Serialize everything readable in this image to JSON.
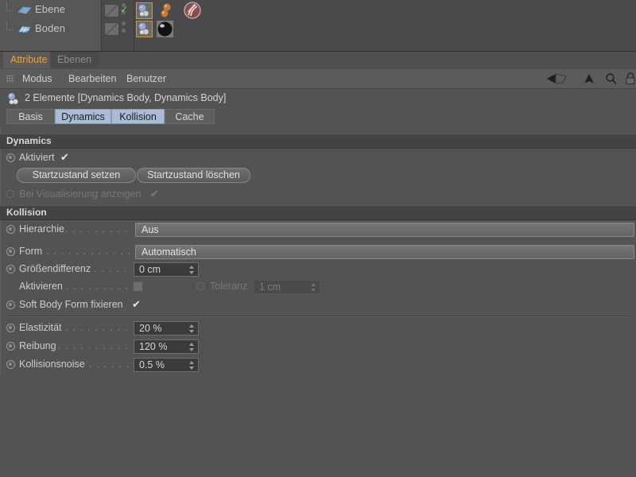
{
  "object_manager": {
    "rows": [
      {
        "name": "Ebene",
        "icon": "plane-icon",
        "visibility_dots": 2,
        "enabled_check": "✓",
        "tags": [
          "dynamics-body-tag",
          "sphere-tag",
          "sphere-tag",
          "deformer-tag"
        ]
      },
      {
        "name": "Boden",
        "icon": "floor-grid-icon",
        "visibility_dots": 2,
        "enabled_check": "",
        "tags": [
          "dynamics-body-tag",
          "material-tag"
        ]
      }
    ]
  },
  "panel_tabs": {
    "active": "Attribute",
    "inactive": "Ebenen"
  },
  "menu": {
    "grip": "grip-icon",
    "items": [
      "Modus",
      "Bearbeiten",
      "Benutzer"
    ],
    "tools": [
      "back-arrow-icon",
      "up-arrow-icon",
      "search-icon",
      "lock-icon"
    ]
  },
  "object_title": {
    "icon": "dynamics-body-icon",
    "text": "2 Elemente [Dynamics Body, Dynamics Body]"
  },
  "sub_tabs": [
    {
      "label": "Basis",
      "selected": false
    },
    {
      "label": "Dynamics",
      "selected": true
    },
    {
      "label": "Kollision",
      "selected": true
    },
    {
      "label": "Cache",
      "selected": false
    }
  ],
  "sections": {
    "dynamics": {
      "title": "Dynamics",
      "aktiviert": {
        "label": "Aktiviert",
        "checked": true,
        "check_glyph": "✔"
      },
      "buttons": [
        {
          "label": "Startzustand setzen"
        },
        {
          "label": "Startzustand löschen"
        }
      ],
      "visualisierung": {
        "label": "Bei Visualisierung anzeigen",
        "checked": true,
        "check_glyph": "✔",
        "disabled": true
      }
    },
    "kollision": {
      "title": "Kollision",
      "hierarchie": {
        "label": "Hierarchie",
        "dots": ". . . . . . . . . . . .",
        "value": "Aus"
      },
      "form": {
        "label": "Form",
        "dots": ". . . . . . . . . . . . . . . .",
        "value": "Automatisch"
      },
      "groessendifferenz": {
        "label": "Größendifferenz",
        "dots": ". . . . . . . .",
        "value": "0 cm"
      },
      "aktivieren": {
        "label": "Aktivieren",
        "dots": ". . . . . . . . . . . . .",
        "checked": false
      },
      "toleranz": {
        "label": "Toleranz",
        "value": "1 cm",
        "disabled": true
      },
      "softbody": {
        "label": "Soft Body Form fixieren",
        "checked": true,
        "check_glyph": "✔"
      },
      "elastizitaet": {
        "label": "Elastizität",
        "dots": ". . . . . . . . . . . . .",
        "value": "20 %"
      },
      "reibung": {
        "label": "Reibung",
        "dots": ". . . . . . . . . . . . . . .",
        "value": "120 %"
      },
      "kollisionsnoise": {
        "label": "Kollisionsnoise",
        "dots": ". . . . . . . . .",
        "value": "0.5 %"
      }
    }
  },
  "colors": {
    "panel_bg": "#535353",
    "section_header_bg": "#434343",
    "accent_tab": "#e8a33d",
    "selected_tab_bg": "#a9bcd6",
    "tag_highlight": "#c89a47",
    "check_green": "#5fe05f"
  }
}
